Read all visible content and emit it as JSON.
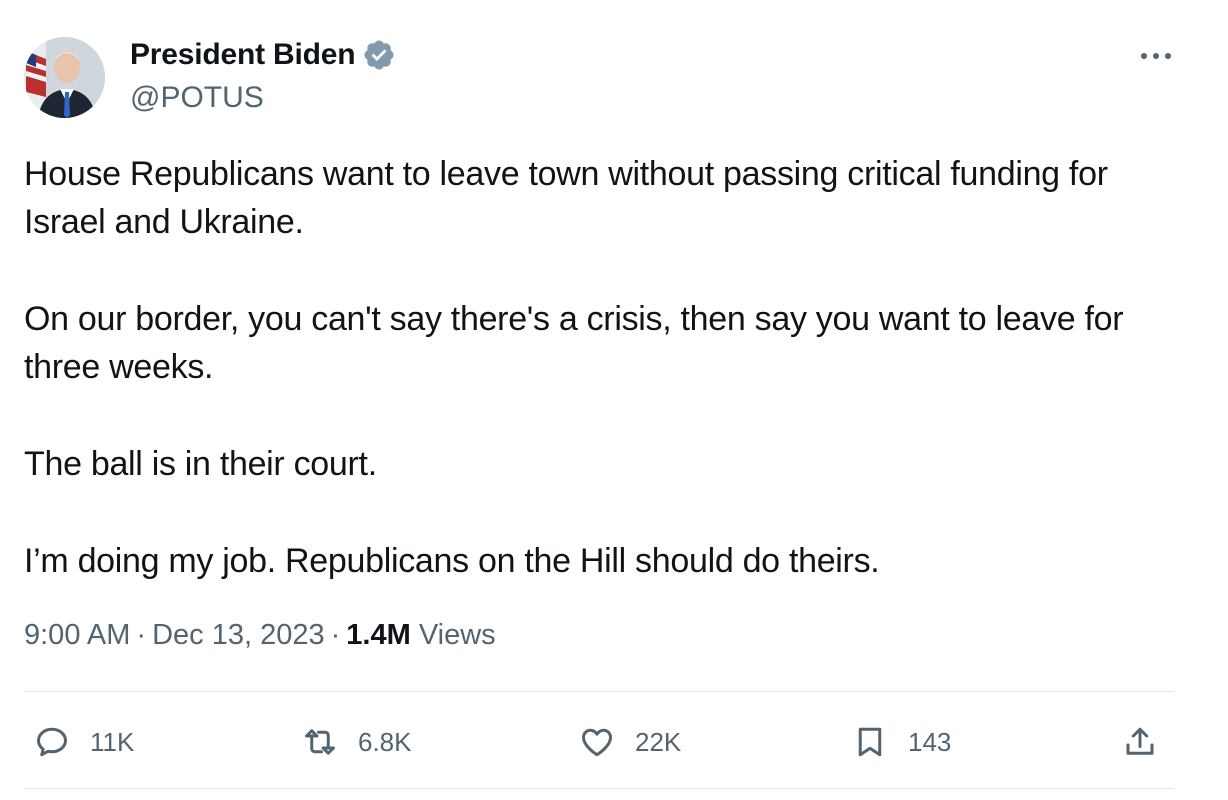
{
  "author": {
    "name": "President Biden",
    "handle": "@POTUS",
    "verified_icon": "verified-badge-icon",
    "avatar": "avatar"
  },
  "more_icon": "more-options-icon",
  "tweet": {
    "paragraphs": [
      "House Republicans want to leave town without passing critical funding for Israel and Ukraine.",
      "On our border, you can't say there's a crisis, then say you want to leave for three weeks.",
      "The ball is in their court.",
      "I’m doing my job. Republicans on the Hill should do theirs."
    ]
  },
  "meta": {
    "time": "9:00 AM",
    "separator": "·",
    "date": "Dec 13, 2023",
    "views_count": "1.4M",
    "views_label": "Views"
  },
  "actions": {
    "reply": {
      "icon": "reply-icon",
      "count": "11K"
    },
    "retweet": {
      "icon": "retweet-icon",
      "count": "6.8K"
    },
    "like": {
      "icon": "heart-icon",
      "count": "22K"
    },
    "bookmark": {
      "icon": "bookmark-icon",
      "count": "143"
    },
    "share": {
      "icon": "share-icon"
    }
  },
  "colors": {
    "text": "#0f1419",
    "secondary": "#536471",
    "verified": "#829aab",
    "divider": "#e7e9ec"
  }
}
